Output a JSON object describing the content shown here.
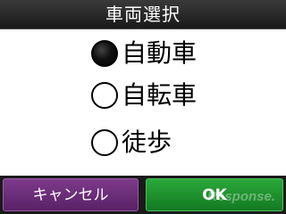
{
  "title": "車両選択",
  "options": [
    {
      "label": "自動車",
      "selected": true
    },
    {
      "label": "自転車",
      "selected": false
    },
    {
      "label": "徒歩",
      "selected": false
    }
  ],
  "buttons": {
    "cancel_label": "キャンセル",
    "ok_label": "OK"
  },
  "watermark": "Response.",
  "colors": {
    "title_bar": "#222222",
    "cancel_button": "#6a2c78",
    "ok_button": "#1f8f2e"
  }
}
